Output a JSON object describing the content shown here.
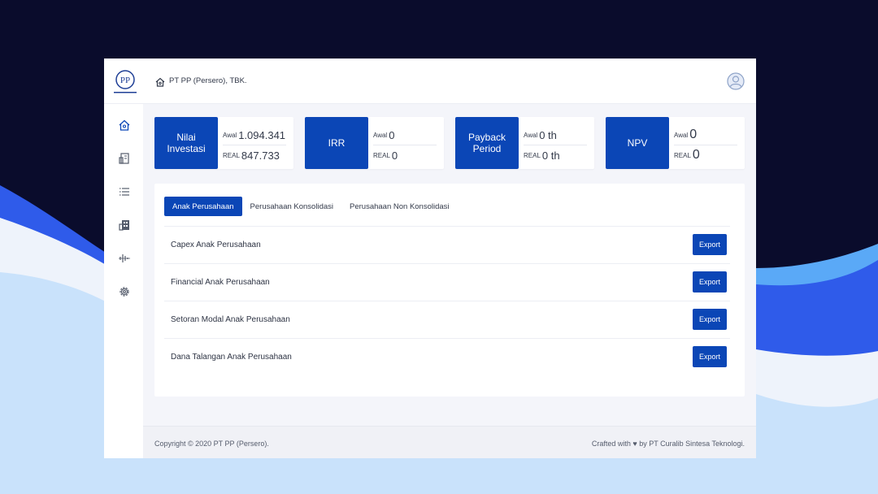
{
  "header": {
    "company_name": "PT PP (Persero), TBK.",
    "logo_icon": "pp-logo",
    "home_icon": "home-icon",
    "avatar_icon": "user-avatar-icon"
  },
  "sidebar": {
    "items": [
      {
        "icon": "home-icon"
      },
      {
        "icon": "building-icon"
      },
      {
        "icon": "list-icon"
      },
      {
        "icon": "office-icon"
      },
      {
        "icon": "waveform-icon"
      },
      {
        "icon": "gear-icon"
      }
    ]
  },
  "stats": [
    {
      "label": "Nilai Investasi",
      "awal_key": "Awal",
      "awal_value": "1.094.341",
      "real_key": "REAL",
      "real_value": "847.733"
    },
    {
      "label": "IRR",
      "awal_key": "Awal",
      "awal_value": "0",
      "real_key": "REAL",
      "real_value": "0"
    },
    {
      "label": "Payback Period",
      "awal_key": "Awal",
      "awal_value": "0 th",
      "real_key": "REAL",
      "real_value": "0 th"
    },
    {
      "label": "NPV",
      "awal_key": "Awal",
      "awal_value": "0",
      "real_key": "REAL",
      "real_value": "0"
    }
  ],
  "tabs": [
    {
      "label": "Anak Perusahaan",
      "active": true
    },
    {
      "label": "Perusahaan Konsolidasi",
      "active": false
    },
    {
      "label": "Perusahaan Non Konsolidasi",
      "active": false
    }
  ],
  "rows": [
    {
      "title": "Capex Anak Perusahaan",
      "button": "Export"
    },
    {
      "title": "Financial Anak Perusahaan",
      "button": "Export"
    },
    {
      "title": "Setoran Modal Anak Perusahaan",
      "button": "Export"
    },
    {
      "title": "Dana Talangan Anak Perusahaan",
      "button": "Export"
    }
  ],
  "footer": {
    "copyright": "Copyright © 2020 PT PP (Persero).",
    "crafted": "Crafted with ♥ by PT Curalib Sintesa Teknologi."
  },
  "colors": {
    "primary": "#0b46b6",
    "background_dark": "#0a0c2c",
    "wave_blue": "#2f5bea",
    "wave_light": "#c9e2fb"
  }
}
